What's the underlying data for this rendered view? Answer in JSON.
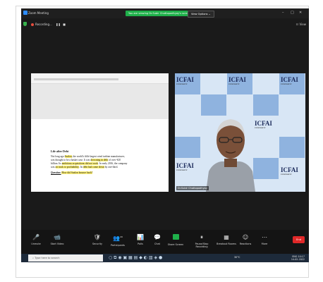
{
  "window": {
    "title": "Zoom Meeting",
    "share_banner": "You are viewing Dr.Subir Chattopadhyay's screen",
    "view_options": "View Options ⌄",
    "view_top": "☷ View"
  },
  "recording": {
    "label": "Recording..."
  },
  "document": {
    "heading": "Life after Debt",
    "paragraph_parts": [
      "Not long ago ",
      "Suzlon",
      ", the world's fifth-largest wind turbine manufacturer, was thought to be a basket case. It was ",
      "drowning in debt",
      " of over ₹20 billion. Its ",
      "ambitious acquisitions did not work",
      ". In early 2016, the company was ",
      "on track to profitability",
      ". Its ",
      "debt had come down",
      " by one-third."
    ],
    "question_label": "Question:",
    "question_text": "How did Suzlon bounce back?"
  },
  "video": {
    "logo_text": "ICFAI",
    "logo_sub": "UNIVERSITY",
    "name_tag": "Dr.Subir Chattopadhyay"
  },
  "controls": [
    {
      "label": "Unmute",
      "icon": "microphone-icon",
      "glyph": "🎤"
    },
    {
      "label": "Start Video",
      "icon": "video-camera-icon",
      "glyph": "📹"
    },
    {
      "label": "Security",
      "icon": "shield-icon",
      "glyph": "🛡"
    },
    {
      "label": "Participants",
      "icon": "participants-icon",
      "glyph": "👥"
    },
    {
      "label": "Polls",
      "icon": "polls-icon",
      "glyph": "📊"
    },
    {
      "label": "Chat",
      "icon": "chat-icon",
      "glyph": "💬"
    },
    {
      "label": "Share Screen",
      "icon": "share-screen-icon",
      "glyph": "⬆"
    },
    {
      "label": "Pause/Stop Recording",
      "icon": "recording-icon",
      "glyph": "⏸"
    },
    {
      "label": "Breakout Rooms",
      "icon": "breakout-rooms-icon",
      "glyph": "▦"
    },
    {
      "label": "Reactions",
      "icon": "reactions-icon",
      "glyph": "☺"
    },
    {
      "label": "More",
      "icon": "more-icon",
      "glyph": "⋯"
    }
  ],
  "participants_count": "49",
  "end_button": "End",
  "taskbar": {
    "search_placeholder": "Type here to search",
    "weather": "30°C",
    "language": "ENG",
    "time": "10:17",
    "date": "14-02-2022"
  }
}
